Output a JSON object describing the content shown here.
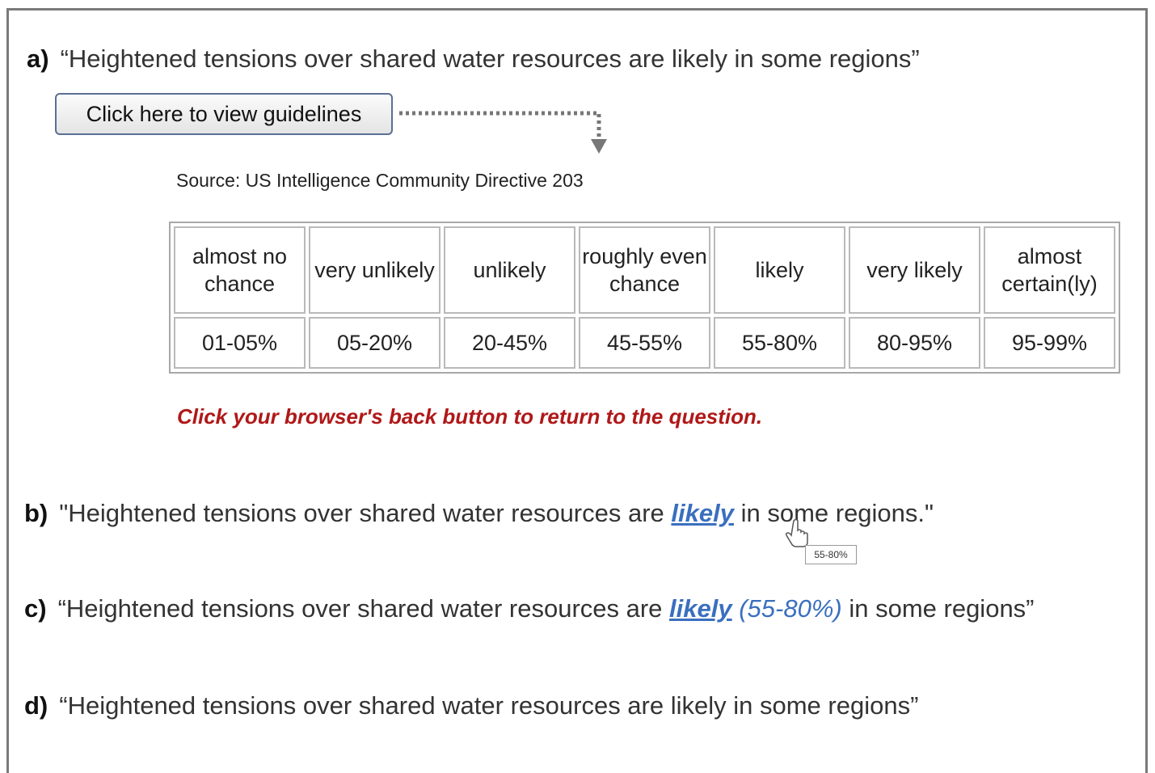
{
  "items": {
    "a": {
      "label": "a)",
      "text": "“Heightened tensions over shared water resources are likely in some regions”"
    },
    "b": {
      "label": "b)",
      "before": "\"Heightened tensions over shared water resources are ",
      "link": "likely",
      "after": " in some regions.\"",
      "tooltip": "55-80%"
    },
    "c": {
      "label": "c)",
      "before": "“Heightened tensions over shared water resources are ",
      "link": "likely",
      "range": "(55-80%)",
      "after": " in some regions”"
    },
    "d": {
      "label": "d)",
      "text": "“Heightened tensions over shared water resources are likely in some regions”"
    }
  },
  "guidelines": {
    "button_label": "Click here to view guidelines",
    "source": "Source: US Intelligence Community Directive 203",
    "terms": [
      "almost no chance",
      "very unlikely",
      "unlikely",
      "roughly even chance",
      "likely",
      "very likely",
      "almost certain(ly)"
    ],
    "ranges": [
      "01-05%",
      "05-20%",
      "20-45%",
      "45-55%",
      "55-80%",
      "80-95%",
      "95-99%"
    ],
    "back_message": "Click your browser's back button to return to the question."
  },
  "colors": {
    "link": "#3a6fbf",
    "back_message": "#b01818",
    "frame": "#7a7a7a"
  },
  "icons": {
    "cursor": "hand-pointer-icon",
    "arrow": "dotted-arrow-icon"
  }
}
